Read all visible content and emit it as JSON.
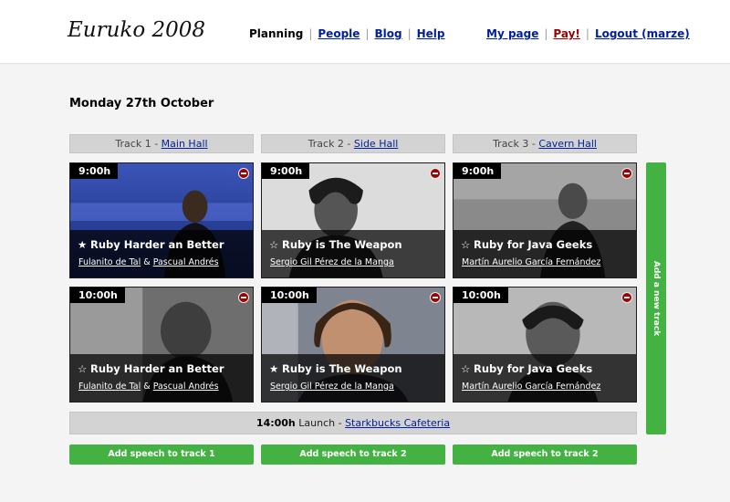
{
  "header": {
    "logo": "Euruko 2008",
    "nav": {
      "planning": "Planning",
      "people": "People",
      "blog": "Blog",
      "help": "Help",
      "my_page": "My page",
      "pay": "Pay!",
      "logout": "Logout (marze)",
      "separator": "|"
    }
  },
  "day": "Monday 27th October",
  "tracks": [
    {
      "prefix": "Track 1 - ",
      "room": "Main Hall"
    },
    {
      "prefix": "Track 2 - ",
      "room": "Side Hall"
    },
    {
      "prefix": "Track 3 - ",
      "room": "Cavern Hall"
    }
  ],
  "talks": {
    "row1": [
      {
        "time": "9:00h",
        "star": "★",
        "title": "Ruby Harder an Better",
        "speaker1": "Fulanito de Tal",
        "amp": " & ",
        "speaker2": "Pascual Andrés"
      },
      {
        "time": "9:00h",
        "star": "☆",
        "title": "Ruby is The Weapon",
        "speaker1": "Sergio Gil Pérez de la Manga"
      },
      {
        "time": "9:00h",
        "star": "☆",
        "title": "Ruby for Java Geeks",
        "speaker1": "Martín Aurelio García Fernández"
      }
    ],
    "row2": [
      {
        "time": "10:00h",
        "star": "☆",
        "title": "Ruby Harder an Better",
        "speaker1": "Fulanito de Tal",
        "amp": " & ",
        "speaker2": "Pascual Andrés"
      },
      {
        "time": "10:00h",
        "star": "★",
        "title": "Ruby is The Weapon",
        "speaker1": "Sergio Gil Pérez de la Manga"
      },
      {
        "time": "10:00h",
        "star": "☆",
        "title": "Ruby for Java Geeks",
        "speaker1": "Martín Aurelio García Fernández"
      }
    ]
  },
  "add_track": "Add a new track",
  "launch": {
    "time": "14:00h",
    "label": " Launch - ",
    "place": "Starkbucks Cafeteria"
  },
  "add_speech": [
    "Add speech to track 1",
    "Add speech to track 2",
    "Add speech to track 2"
  ],
  "colors": {
    "accent": "#44b243",
    "link": "#001f9a",
    "pay": "#9b0000",
    "remove": "#a00000"
  }
}
